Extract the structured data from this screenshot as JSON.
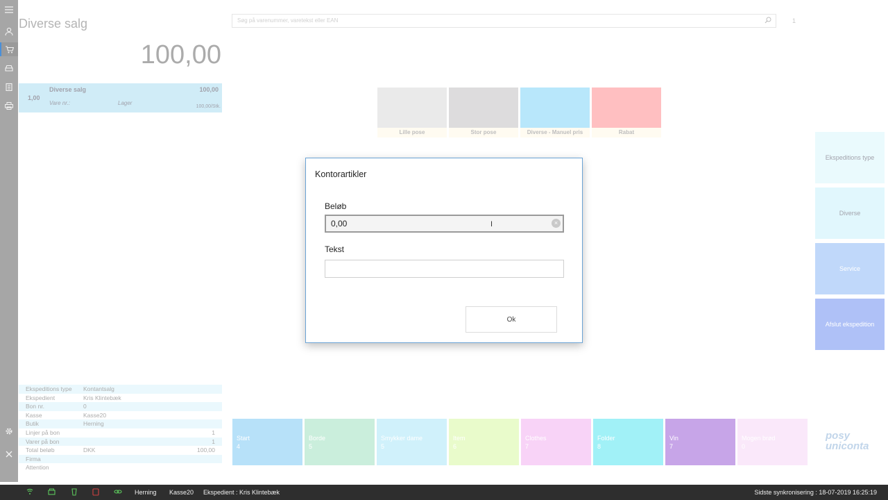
{
  "rail": {
    "icons": [
      "menu-icon",
      "user-icon",
      "cart-icon",
      "car-icon",
      "clipboard-icon",
      "printer-icon",
      "gear-icon",
      "close-icon"
    ]
  },
  "sale": {
    "title": "Diverse salg",
    "total": "100,00",
    "line": {
      "qty": "1,00",
      "name": "Diverse salg",
      "price": "100,00",
      "vare_nr": "Vare nr.:",
      "lager": "Lager",
      "unit_price": "100,00/Stk."
    }
  },
  "search": {
    "placeholder": "Søg på varenummer, varetekst eller EAN",
    "page": "1"
  },
  "quickkeys": [
    {
      "label": "Lille pose",
      "color": "#d9d9d9"
    },
    {
      "label": "Stor pose",
      "color": "#c2c0c2"
    },
    {
      "label": "Diverse - Manuel pris",
      "color": "#7fd3f7"
    },
    {
      "label": "Rabat",
      "color": "#ff8a8f"
    }
  ],
  "right_buttons": [
    {
      "label": "Ekspeditions type",
      "color": "#d9f6fc"
    },
    {
      "label": "Diverse",
      "color": "#c8f1fb"
    },
    {
      "label": "Service",
      "color": "#8db9f6"
    },
    {
      "label": "Afslut ekspedition",
      "color": "#6d8ff0"
    }
  ],
  "info": [
    {
      "key": "Ekspeditions type",
      "value": "Kontantsalg",
      "num": ""
    },
    {
      "key": "Ekspedient",
      "value": "Kris Klintebæk",
      "num": ""
    },
    {
      "key": "Bon nr.",
      "value": "0",
      "num": ""
    },
    {
      "key": "Kasse",
      "value": "Kasse20",
      "num": ""
    },
    {
      "key": "Butik",
      "value": "Herning",
      "num": ""
    },
    {
      "key": "Linjer på bon",
      "value": "",
      "num": "1"
    },
    {
      "key": "Varer på bon",
      "value": "",
      "num": "1"
    },
    {
      "key": "Total beløb",
      "value": "DKK",
      "num": "100,00"
    },
    {
      "key": "Firma",
      "value": "",
      "num": ""
    },
    {
      "key": "Attention",
      "value": "",
      "num": ""
    }
  ],
  "tiles": [
    {
      "name": "Start",
      "count": "4",
      "color": "#7cc8f5"
    },
    {
      "name": "Borde",
      "count": "5",
      "color": "#9fe0c0"
    },
    {
      "name": "Smykker dame",
      "count": "5",
      "color": "#a9e6f7"
    },
    {
      "name": "Item",
      "count": "6",
      "color": "#d8f7a0"
    },
    {
      "name": "Clothes",
      "count": "7",
      "color": "#f2b0f0"
    },
    {
      "name": "Folder",
      "count": "8",
      "color": "#55e6f0"
    },
    {
      "name": "Vin",
      "count": "7",
      "color": "#9a5bd6"
    },
    {
      "name": "Mogen brød",
      "count": "0",
      "color": "#f6d6f6"
    }
  ],
  "logo": {
    "line1": "posy",
    "line2": "uniconta"
  },
  "status": {
    "store": "Herning",
    "register": "Kasse20",
    "clerk": "Ekspedient : Kris Klintebæk",
    "sync": "Sidste synkronisering : 18-07-2019 16:25:19",
    "icons": [
      "wifi-icon",
      "cash-drawer-icon",
      "receipt-printer-icon",
      "card-terminal-icon",
      "link-icon"
    ]
  },
  "dialog": {
    "title": "Kontorartikler",
    "amount_label": "Beløb",
    "amount_value": "0,00",
    "text_label": "Tekst",
    "text_value": "",
    "ok_label": "Ok"
  }
}
